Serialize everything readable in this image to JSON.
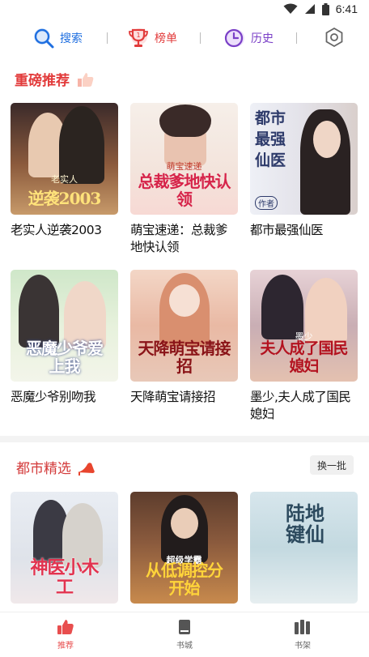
{
  "status_bar": {
    "time": "6:41"
  },
  "top_nav": {
    "search_label": "搜索",
    "rank_label": "榜单",
    "history_label": "历史",
    "colors": {
      "search": "#1f6fe0",
      "rank": "#e23b3b",
      "history": "#7a3fc7"
    }
  },
  "sections": [
    {
      "title": "重磅推荐",
      "books": [
        {
          "name": "老实人逆袭2003",
          "cover_text": "逆袭2003",
          "cover_subtext": "老实人"
        },
        {
          "name": "萌宝速递：总裁爹地快认领",
          "cover_text": "总裁爹地快认领",
          "cover_subtext": "萌宝速递"
        },
        {
          "name": "都市最强仙医",
          "cover_text": "都市最强仙医",
          "cover_subtext": "作者"
        },
        {
          "name": "恶魔少爷别吻我",
          "cover_text": "恶魔少爷爱上我",
          "cover_subtext": ""
        },
        {
          "name": "天降萌宝请接招",
          "cover_text": "天降萌宝请接招",
          "cover_subtext": ""
        },
        {
          "name": "墨少,夫人成了国民媳妇",
          "cover_text": "夫人成了国民媳妇",
          "cover_subtext": "墨少"
        }
      ]
    },
    {
      "title": "都市精选",
      "action_label": "换一批",
      "books": [
        {
          "cover_text": "神医小木工",
          "cover_subtext": ""
        },
        {
          "cover_text": "从低调控分开始",
          "cover_subtext": "超级学霸"
        },
        {
          "cover_text": "陆地键仙",
          "cover_subtext": ""
        }
      ]
    }
  ],
  "tab_bar": {
    "tabs": [
      {
        "label": "推荐",
        "active": true
      },
      {
        "label": "书城",
        "active": false
      },
      {
        "label": "书架",
        "active": false
      }
    ],
    "active_color": "#e84e4e"
  }
}
